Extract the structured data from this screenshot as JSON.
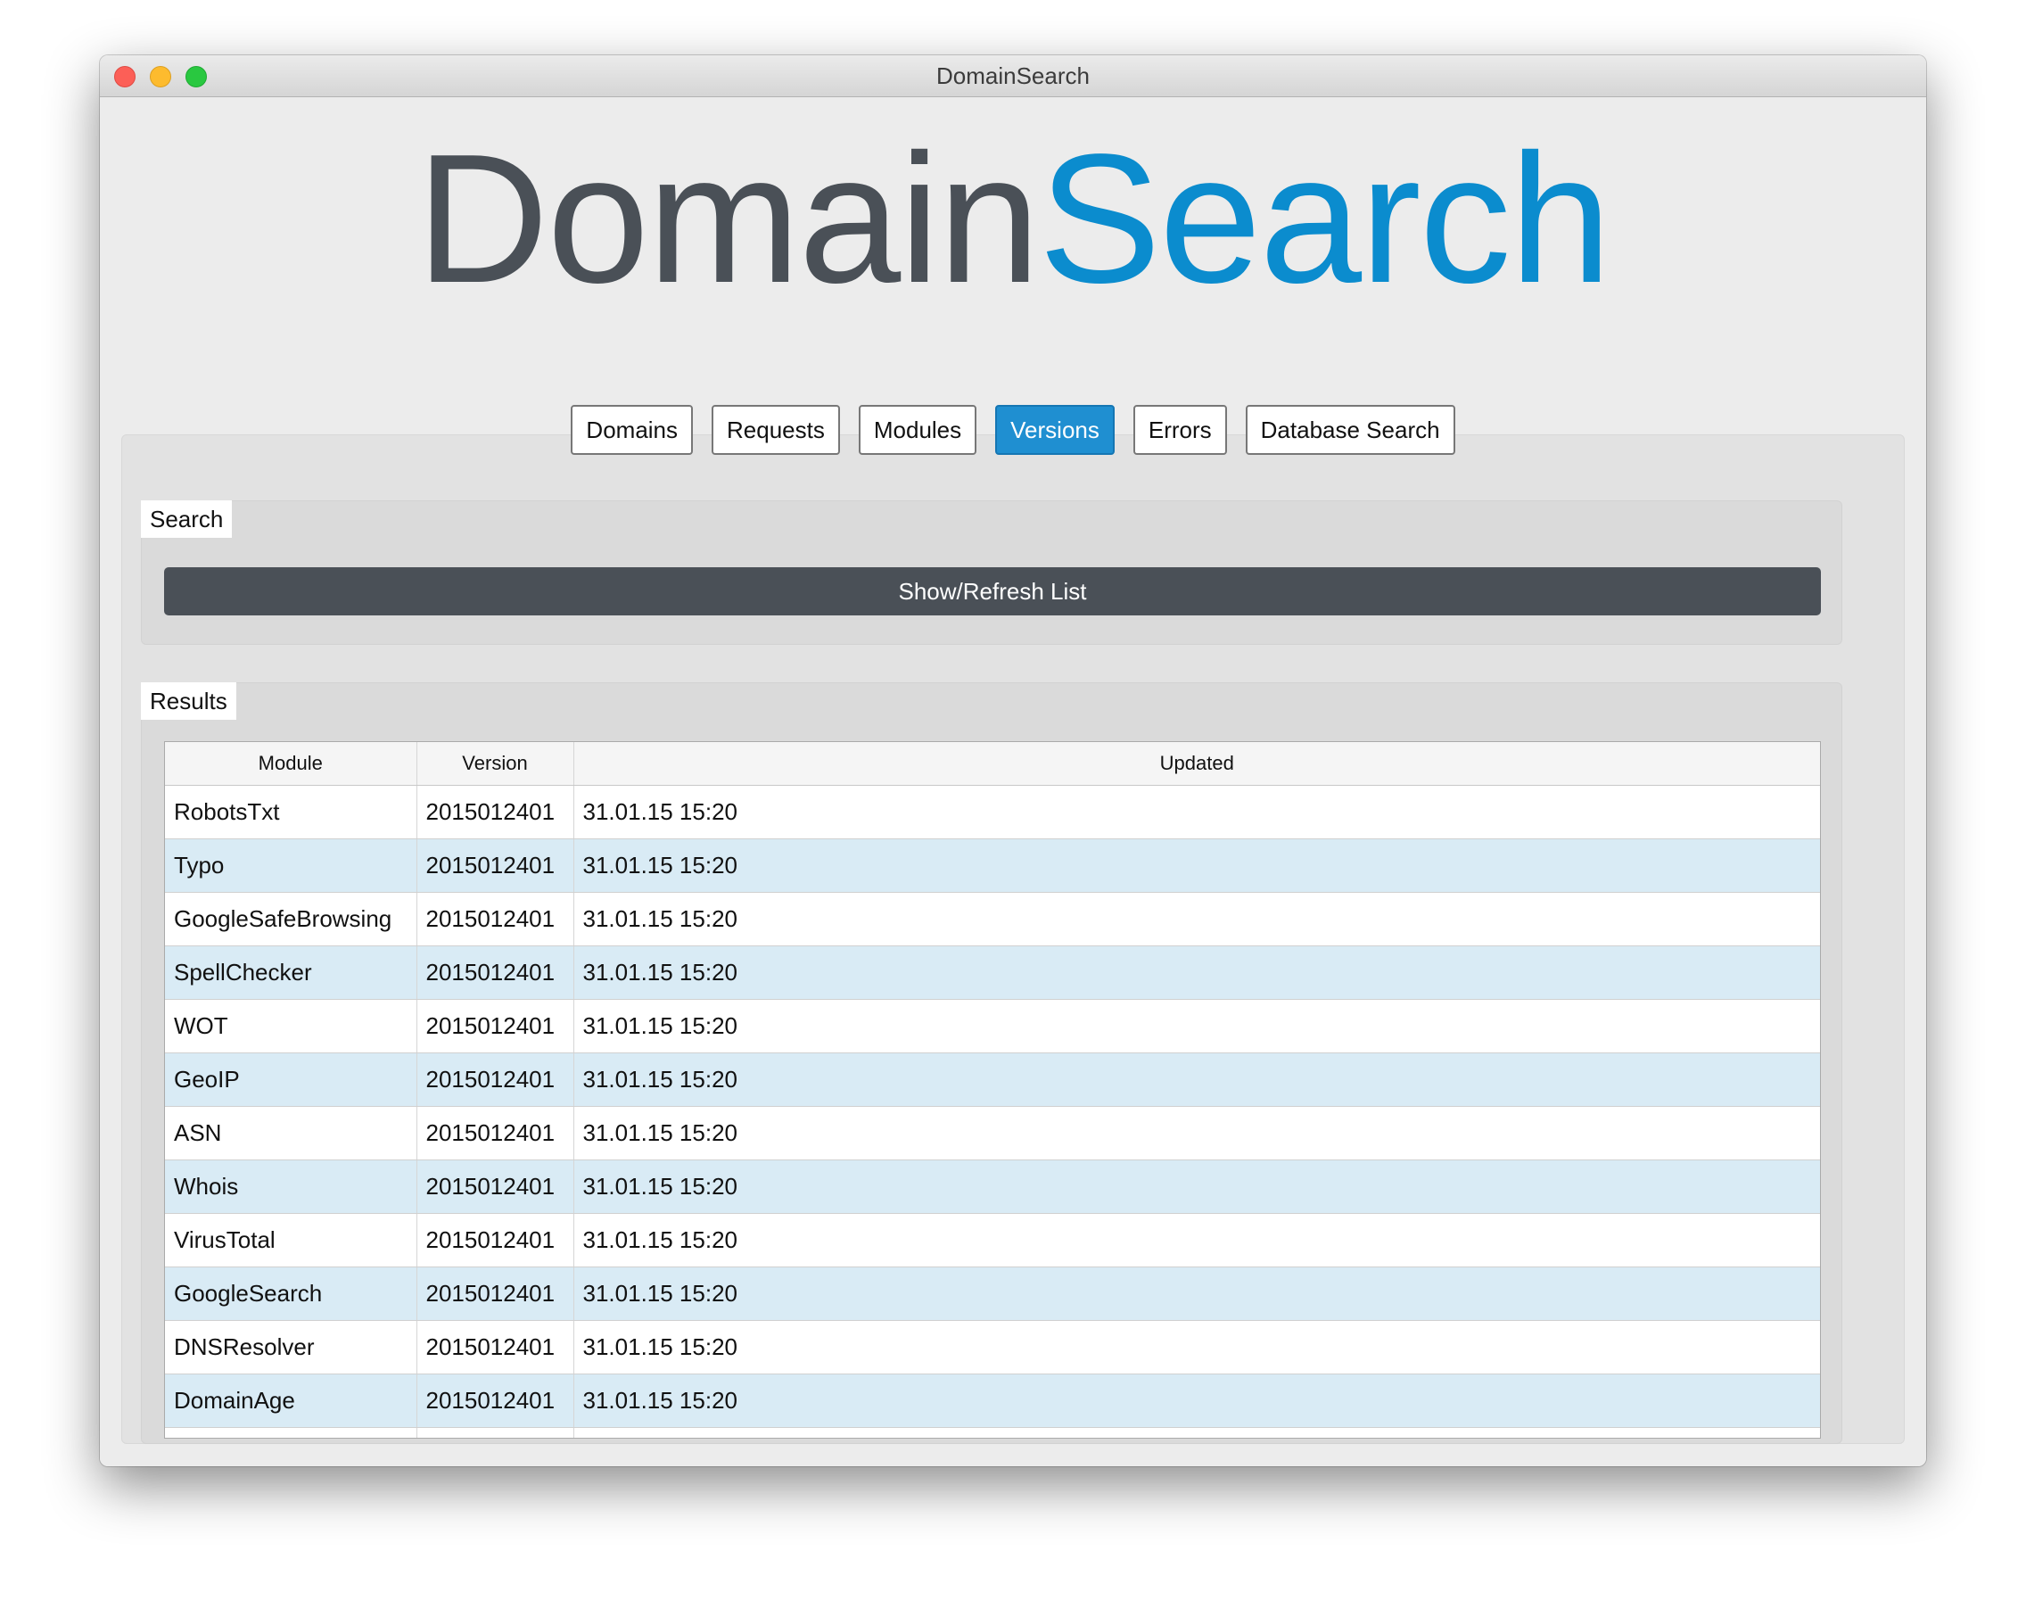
{
  "window": {
    "title": "DomainSearch"
  },
  "logo": {
    "part1": "Domain",
    "part2": "Search"
  },
  "tabs": [
    "Domains",
    "Requests",
    "Modules",
    "Versions",
    "Errors",
    "Database Search"
  ],
  "active_tab": "Versions",
  "search": {
    "group_label": "Search",
    "button_label": "Show/Refresh List"
  },
  "results": {
    "group_label": "Results",
    "columns": [
      "Module",
      "Version",
      "Updated"
    ],
    "rows": [
      [
        "RobotsTxt",
        "2015012401",
        "31.01.15 15:20"
      ],
      [
        "Typo",
        "2015012401",
        "31.01.15 15:20"
      ],
      [
        "GoogleSafeBrowsing",
        "2015012401",
        "31.01.15 15:20"
      ],
      [
        "SpellChecker",
        "2015012401",
        "31.01.15 15:20"
      ],
      [
        "WOT",
        "2015012401",
        "31.01.15 15:20"
      ],
      [
        "GeoIP",
        "2015012401",
        "31.01.15 15:20"
      ],
      [
        "ASN",
        "2015012401",
        "31.01.15 15:20"
      ],
      [
        "Whois",
        "2015012401",
        "31.01.15 15:20"
      ],
      [
        "VirusTotal",
        "2015012401",
        "31.01.15 15:20"
      ],
      [
        "GoogleSearch",
        "2015012401",
        "31.01.15 15:20"
      ],
      [
        "DNSResolver",
        "2015012401",
        "31.01.15 15:20"
      ],
      [
        "DomainAge",
        "2015012401",
        "31.01.15 15:20"
      ],
      [
        "",
        "",
        ""
      ]
    ]
  },
  "colors": {
    "accent": "#0b8cce",
    "logo_dark": "#4a5057",
    "active_tab": "#1f8fd1",
    "button_dark": "#4a5057",
    "row_alt": "#d9ebf5"
  }
}
